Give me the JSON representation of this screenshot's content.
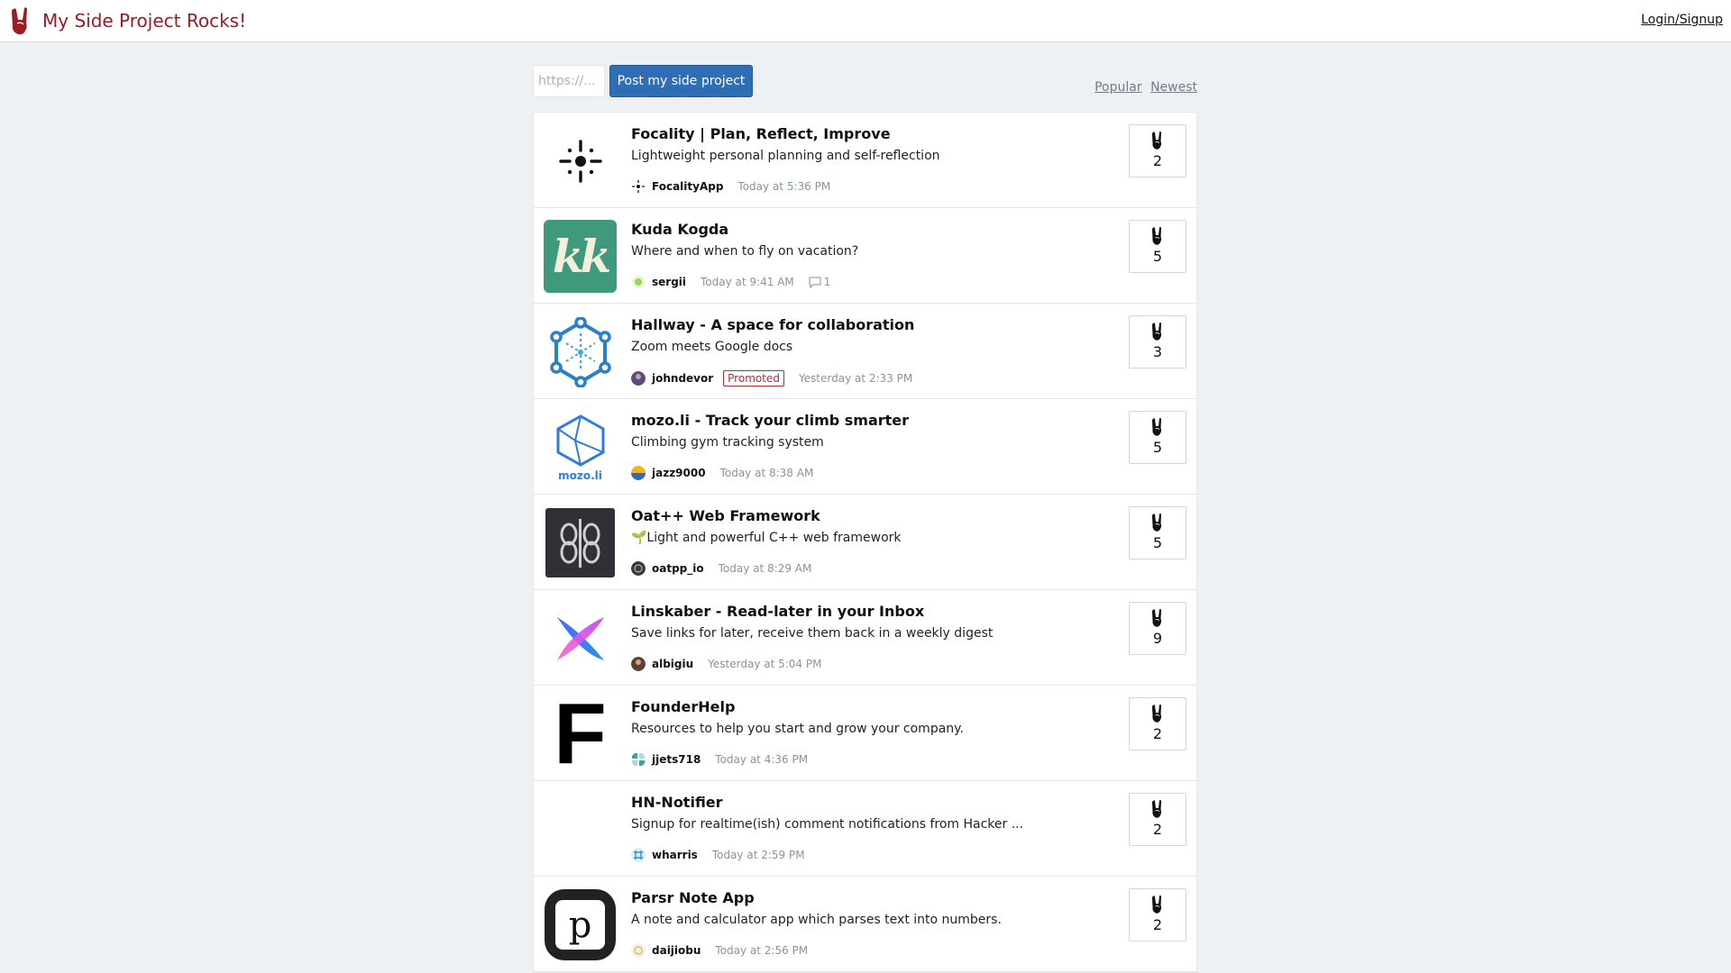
{
  "header": {
    "title": "My Side Project Rocks!",
    "login": "Login/Signup"
  },
  "toolbar": {
    "url_placeholder": "https://...",
    "post_label": "Post my side project",
    "sort_popular": "Popular",
    "sort_newest": "Newest"
  },
  "colors": {
    "brand": "#9b1c22",
    "button": "#2f6db5",
    "background": "#eef1f4"
  },
  "projects": [
    {
      "title": "Focality | Plan, Reflect, Improve",
      "subtitle": "Lightweight personal planning and self-reflection",
      "user": "FocalityApp",
      "time": "Today at 5:36 PM",
      "votes": "2",
      "logo": "focality-logo"
    },
    {
      "title": "Kuda Kogda",
      "subtitle": "Where and when to fly on vacation?",
      "user": "sergii",
      "time": "Today at 9:41 AM",
      "comments": "1",
      "votes": "5",
      "logo": "kk-logo",
      "logo_text": "kk"
    },
    {
      "title": "Hallway - A space for collaboration",
      "subtitle": "Zoom meets Google docs",
      "user": "johndevor",
      "badge": "Promoted",
      "time": "Yesterday at 2:33 PM",
      "votes": "3",
      "logo": "hallway-logo"
    },
    {
      "title": "mozo.li - Track your climb smarter",
      "subtitle": "Climbing gym tracking system",
      "user": "jazz9000",
      "time": "Today at 8:38 AM",
      "votes": "5",
      "logo": "mozo-logo",
      "logo_text": "mozo.li"
    },
    {
      "title": "Oat++ Web Framework",
      "subtitle": "🌱Light and powerful C++ web framework",
      "user": "oatpp_io",
      "time": "Today at 8:29 AM",
      "votes": "5",
      "logo": "oatpp-logo"
    },
    {
      "title": "Linskaber - Read-later in your Inbox",
      "subtitle": "Save links for later, receive them back in a weekly digest",
      "user": "albigiu",
      "time": "Yesterday at 5:04 PM",
      "votes": "9",
      "logo": "linskaber-logo"
    },
    {
      "title": "FounderHelp",
      "subtitle": "Resources to help you start and grow your company.",
      "user": "jjets718",
      "time": "Today at 4:36 PM",
      "votes": "2",
      "logo": "founderhelp-logo",
      "logo_text": "F"
    },
    {
      "title": "HN-Notifier",
      "subtitle": "Signup for realtime(ish) comment notifications from Hacker ...",
      "user": "wharris",
      "time": "Today at 2:59 PM",
      "votes": "2",
      "logo": "none"
    },
    {
      "title": "Parsr Note App",
      "subtitle": "A note and calculator app which parses text into numbers.",
      "user": "daijiobu",
      "time": "Today at 2:56 PM",
      "votes": "2",
      "logo": "parsr-logo",
      "logo_text": "p"
    }
  ]
}
